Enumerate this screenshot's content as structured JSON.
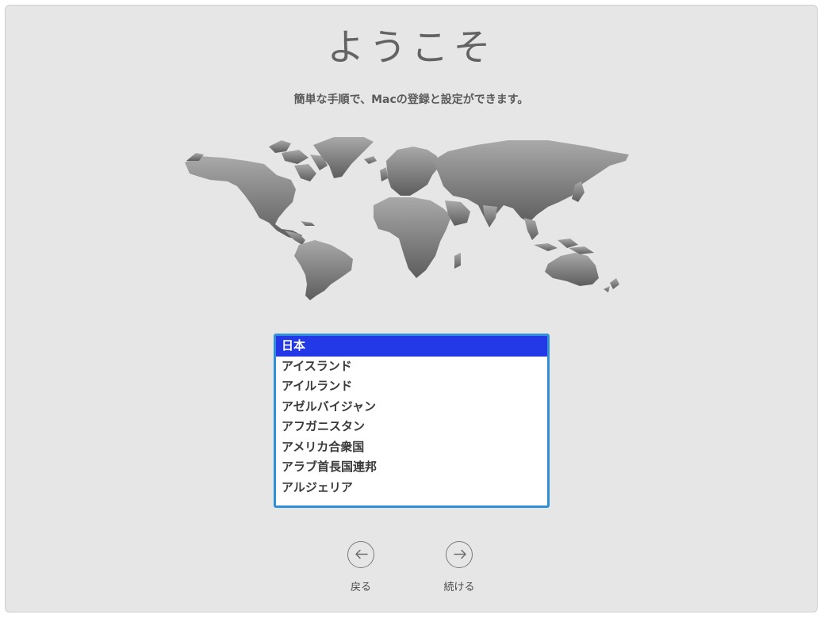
{
  "welcome": {
    "title": "ようこそ",
    "subtitle": "簡単な手順で、Macの登録と設定ができます。"
  },
  "country_list": {
    "selected": "日本",
    "items": [
      "日本",
      "アイスランド",
      "アイルランド",
      "アゼルバイジャン",
      "アフガニスタン",
      "アメリカ合衆国",
      "アラブ首長国連邦",
      "アルジェリア"
    ]
  },
  "navigation": {
    "back_label": "戻る",
    "continue_label": "続ける"
  },
  "icons": {
    "back": "arrow-left-circle-icon",
    "continue": "arrow-right-circle-icon"
  },
  "colors": {
    "selection": "#2338e6",
    "focus_ring": "#2f8fd8",
    "panel_background": "#e6e6e6"
  }
}
